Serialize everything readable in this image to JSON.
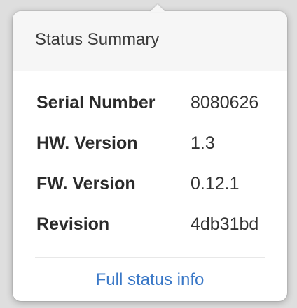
{
  "popover": {
    "title": "Status Summary",
    "rows": [
      {
        "label": "Serial Number",
        "value": "8080626"
      },
      {
        "label": "HW. Version",
        "value": "1.3"
      },
      {
        "label": "FW. Version",
        "value": "0.12.1"
      },
      {
        "label": "Revision",
        "value": "4db31bd"
      }
    ],
    "link_label": "Full status info"
  },
  "colors": {
    "link": "#3a78c7",
    "header_bg": "#f6f6f6",
    "text": "#333333"
  }
}
